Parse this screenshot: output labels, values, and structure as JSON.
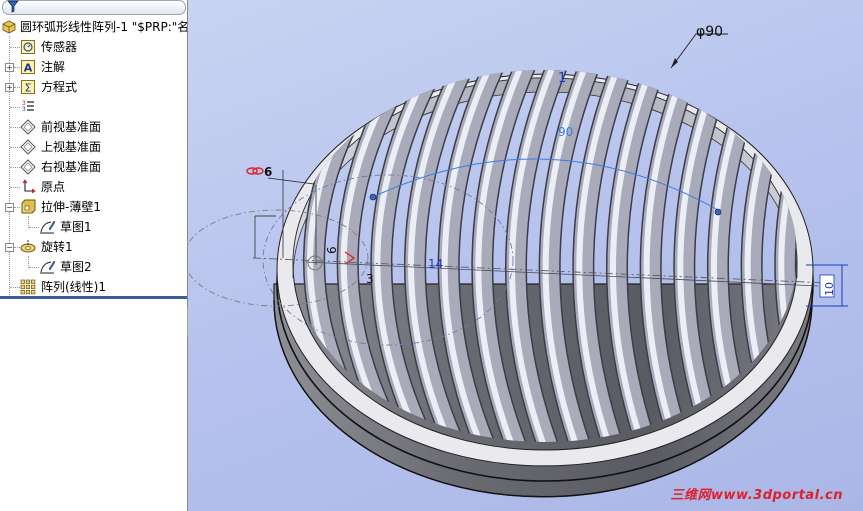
{
  "feature_tree": {
    "root": "圆环弧形线性阵列-1 \"$PRP:\"名",
    "items": [
      {
        "label": "传感器",
        "icon": "sensor-icon",
        "expandable": false
      },
      {
        "label": "注解",
        "icon": "annotation-icon",
        "expandable": true
      },
      {
        "label": "方程式",
        "icon": "equation-icon",
        "expandable": true
      },
      {
        "label": "",
        "icon": "material-icon",
        "expandable": false
      },
      {
        "label": "前视基准面",
        "icon": "plane-icon",
        "expandable": false
      },
      {
        "label": "上视基准面",
        "icon": "plane-icon",
        "expandable": false
      },
      {
        "label": "右视基准面",
        "icon": "plane-icon",
        "expandable": false
      },
      {
        "label": "原点",
        "icon": "origin-icon",
        "expandable": false
      },
      {
        "label": "拉伸-薄壁1",
        "icon": "extrude-icon",
        "expandable": true
      },
      {
        "label": "草图1",
        "icon": "sketch-icon",
        "expandable": false
      },
      {
        "label": "旋转1",
        "icon": "revolve-icon",
        "expandable": true
      },
      {
        "label": "草图2",
        "icon": "sketch-icon",
        "expandable": false
      },
      {
        "label": "阵列(线性)1",
        "icon": "pattern-icon",
        "expandable": false
      }
    ]
  },
  "viewport": {
    "dimensions": {
      "diameter": "φ90",
      "arc": "90",
      "pipe_diameter": "6",
      "small_vertical": "6",
      "small_value": "3",
      "spacing": "14",
      "height": "10",
      "marker": "1"
    },
    "colors": {
      "background": "#b8c4ee",
      "dimension_blue": "#1a3cc8",
      "highlight_red": "#e0202a"
    },
    "watermark": "三维网www.3dportal.cn"
  }
}
